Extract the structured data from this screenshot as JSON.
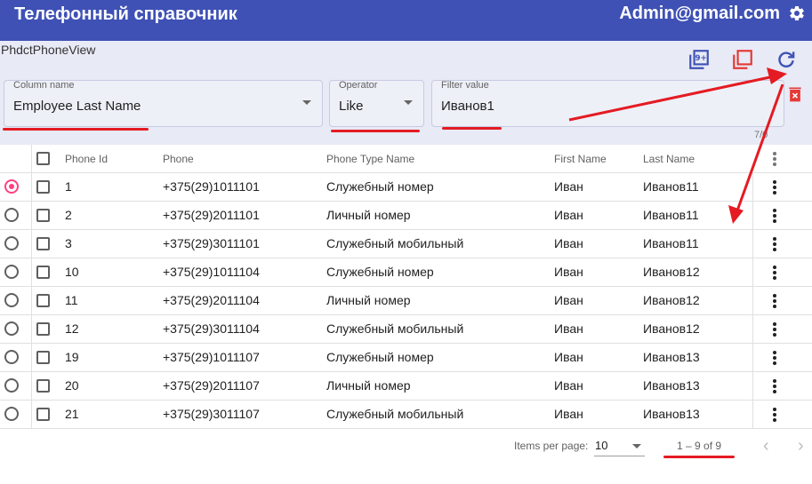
{
  "app": {
    "title": "Телефонный справочник",
    "user": "Admin@gmail.com"
  },
  "view": {
    "name": "PhdctPhoneView"
  },
  "filter": {
    "column": {
      "label": "Column name",
      "value": "Employee Last Name"
    },
    "operator": {
      "label": "Operator",
      "value": "Like"
    },
    "value": {
      "label": "Filter value",
      "value": "Иванов1"
    },
    "count": "7/0"
  },
  "table": {
    "headers": {
      "id": "Phone Id",
      "phone": "Phone",
      "type": "Phone Type Name",
      "first": "First Name",
      "last": "Last Name"
    },
    "rows": [
      {
        "id": "1",
        "phone": "+375(29)1011101",
        "type": "Служебный номер",
        "first": "Иван",
        "last": "Иванов11",
        "selected": true
      },
      {
        "id": "2",
        "phone": "+375(29)2011101",
        "type": "Личный номер",
        "first": "Иван",
        "last": "Иванов11",
        "selected": false
      },
      {
        "id": "3",
        "phone": "+375(29)3011101",
        "type": "Служебный мобильный",
        "first": "Иван",
        "last": "Иванов11",
        "selected": false
      },
      {
        "id": "10",
        "phone": "+375(29)1011104",
        "type": "Служебный номер",
        "first": "Иван",
        "last": "Иванов12",
        "selected": false
      },
      {
        "id": "11",
        "phone": "+375(29)2011104",
        "type": "Личный номер",
        "first": "Иван",
        "last": "Иванов12",
        "selected": false
      },
      {
        "id": "12",
        "phone": "+375(29)3011104",
        "type": "Служебный мобильный",
        "first": "Иван",
        "last": "Иванов12",
        "selected": false
      },
      {
        "id": "19",
        "phone": "+375(29)1011107",
        "type": "Служебный номер",
        "first": "Иван",
        "last": "Иванов13",
        "selected": false
      },
      {
        "id": "20",
        "phone": "+375(29)2011107",
        "type": "Личный номер",
        "first": "Иван",
        "last": "Иванов13",
        "selected": false
      },
      {
        "id": "21",
        "phone": "+375(29)3011107",
        "type": "Служебный мобильный",
        "first": "Иван",
        "last": "Иванов13",
        "selected": false
      }
    ]
  },
  "paginator": {
    "label": "Items per page:",
    "page_size": "10",
    "range": "1 – 9 of 9",
    "prev": "‹",
    "next": "›"
  },
  "colors": {
    "primary": "#3f51b5",
    "filter_bg": "#e8eaf6",
    "accent": "#ff4081",
    "annotation": "#e41b23",
    "delete": "#e53935"
  },
  "icons": [
    "settings-gear-icon",
    "copy-all-icon",
    "clear-all-icon",
    "refresh-icon",
    "delete-filter-icon",
    "more-vert-icon"
  ]
}
